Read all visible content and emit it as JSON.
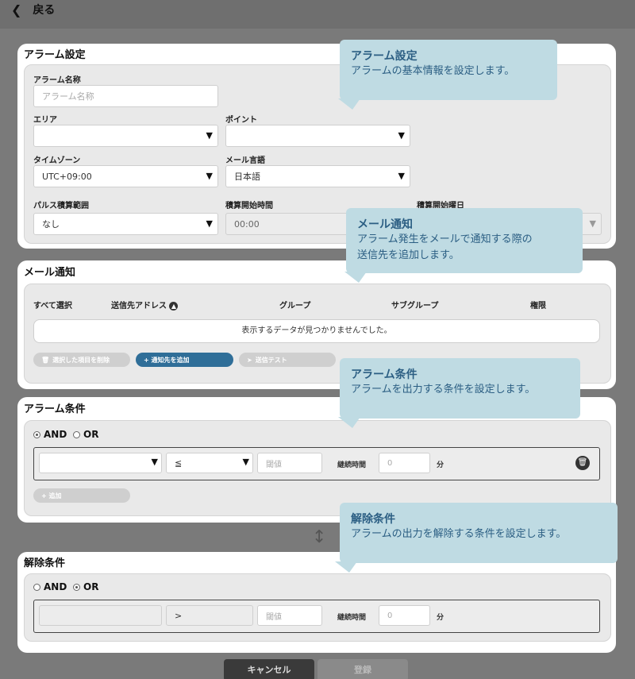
{
  "nav": {
    "back_label": "戻る"
  },
  "alarm_settings": {
    "title": "アラーム設定",
    "name_label": "アラーム名称",
    "name_placeholder": "アラーム名称",
    "area_label": "エリア",
    "point_label": "ポイント",
    "timezone_label": "タイムゾーン",
    "timezone_value": "UTC+09:00",
    "mail_lang_label": "メール言語",
    "mail_lang_value": "日本語",
    "pulse_label": "パルス積算範囲",
    "pulse_value": "なし",
    "start_time_label": "積算開始時間",
    "start_time_value": "00:00",
    "start_day_label": "積算開始曜日"
  },
  "mail": {
    "title": "メール通知",
    "headers": [
      "すべて選択",
      "送信先アドレス",
      "グループ",
      "サブグループ",
      "権限"
    ],
    "empty_text": "表示するデータが見つかりませんでした。",
    "delete_label": "選択した項目を削除",
    "add_label": "+ 通知先を追加",
    "test_label": "送信テスト"
  },
  "alarm_condition": {
    "title": "アラーム条件",
    "and_label": "AND",
    "or_label": "OR",
    "operator": "≦",
    "threshold_placeholder": "閾値",
    "duration_label": "継続時間",
    "duration_value": "0",
    "unit": "分",
    "add_label": "+ 追加",
    "selected": "AND"
  },
  "release_condition": {
    "title": "解除条件",
    "and_label": "AND",
    "or_label": "OR",
    "operator": ">",
    "threshold_placeholder": "閾値",
    "duration_label": "継続時間",
    "duration_value": "0",
    "unit": "分",
    "selected": "OR"
  },
  "tooltips": {
    "t1_title": "アラーム設定",
    "t1_body": "アラームの基本情報を設定します。",
    "t2_title": "メール通知",
    "t2_body1": "アラーム発生をメールで通知する際の",
    "t2_body2": "送信先を追加します。",
    "t3_title": "アラーム条件",
    "t3_body": "アラームを出力する条件を設定します。",
    "t4_title": "解除条件",
    "t4_body": "アラームの出力を解除する条件を設定します。"
  },
  "footer": {
    "cancel_label": "キャンセル",
    "register_label": "登録"
  }
}
